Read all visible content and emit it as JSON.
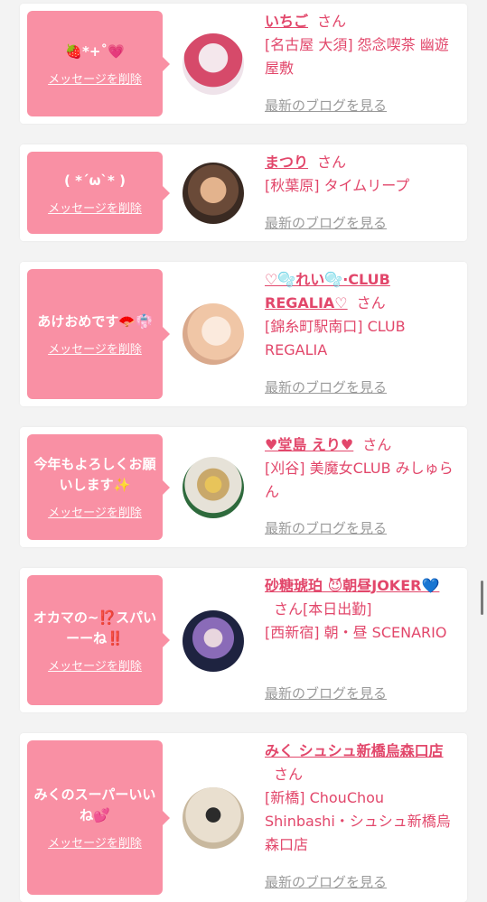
{
  "entries": [
    {
      "message": "🍓*+˚💗",
      "delete_label": "メッセージを削除",
      "name": "いちご",
      "honorific": "さん",
      "area": "[名古屋 大須] 怨念喫茶 幽遊屋敷",
      "blog_label": "最新のブログを見る",
      "avatar_colors": [
        "#d64a6a",
        "#f4e7ec"
      ]
    },
    {
      "message": "( *´ω`* )",
      "delete_label": "メッセージを削除",
      "name": "まつり",
      "honorific": "さん",
      "area": "[秋葉原] タイムリープ",
      "blog_label": "最新のブログを見る",
      "avatar_colors": [
        "#3a2a22",
        "#e3b38d"
      ]
    },
    {
      "message": "あけおめです🪭👘",
      "delete_label": "メッセージを削除",
      "name": "♡🫧れい🫧·CLUB REGALIA♡",
      "honorific": "さん",
      "area": "[錦糸町駅南口] CLUB REGALIA",
      "blog_label": "最新のブログを見る",
      "avatar_colors": [
        "#f0c6a6",
        "#fbeadd"
      ]
    },
    {
      "message": "今年もよろしくお願いします✨",
      "delete_label": "メッセージを削除",
      "name": "♥堂島 えり♥",
      "honorific": "さん",
      "area": "[刈谷] 美魔女CLUB みしゅらん",
      "blog_label": "最新のブログを見る",
      "avatar_colors": [
        "#2e6a3c",
        "#e6e2d8"
      ]
    },
    {
      "message": "オカマの~⁉️スパいーーね‼️",
      "delete_label": "メッセージを削除",
      "name": "砂糖琥珀 😈朝昼JOKER💙",
      "honorific": "さん[本日出勤]",
      "area": "[西新宿] 朝・昼 SCENARIO",
      "blog_label": "最新のブログを見る",
      "avatar_colors": [
        "#1e2340",
        "#8a6bb8"
      ]
    },
    {
      "message": "みくのスーパーいいね💕",
      "delete_label": "メッセージを削除",
      "name": "みく シュシュ新橋烏森口店",
      "honorific": "さん",
      "area": "[新橋] ChouChou Shinbashi・シュシュ新橋烏森口店",
      "blog_label": "最新のブログを見る",
      "avatar_colors": [
        "#2b2b2b",
        "#e9dfcf"
      ]
    }
  ],
  "colors": {
    "accent": "#e2476b",
    "bubble": "#f990a4",
    "link_gray": "#9a9a9a",
    "background": "#f3f3f3"
  }
}
